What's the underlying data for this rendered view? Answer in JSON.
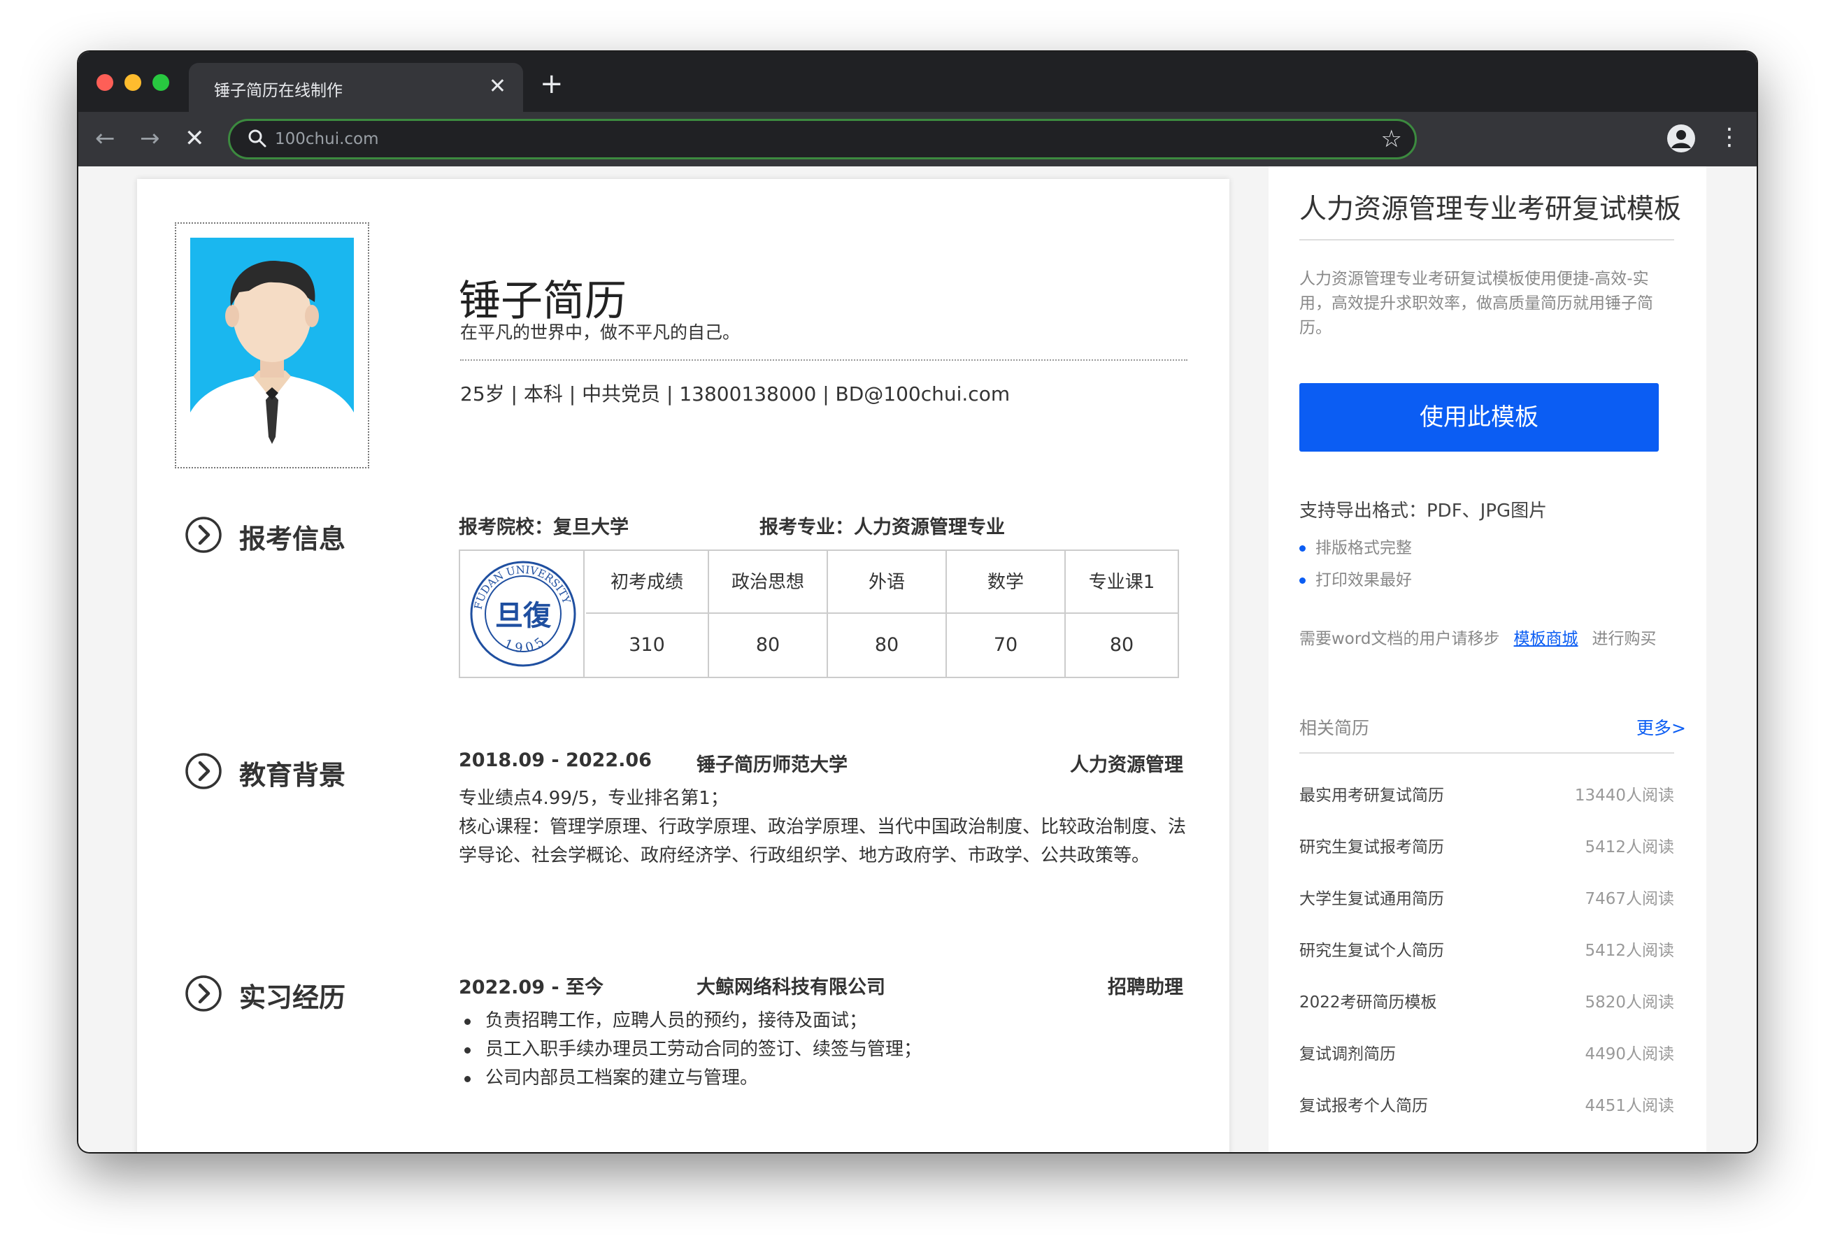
{
  "browser": {
    "tab_title": "锤子简历在线制作",
    "tab_close": "✕",
    "new_tab": "+",
    "url": "100chui.com",
    "nav_back": "←",
    "nav_forward": "→",
    "nav_stop": "✕",
    "star": "☆",
    "menu": "⋮"
  },
  "resume": {
    "name": "锤子简历",
    "motto": "在平凡的世界中，做不平凡的自己。",
    "contact": "25岁 | 本科 | 中共党员 | 13800138000 | BD@100chui.com",
    "apply": {
      "title": "报考信息",
      "school": "报考院校：复旦大学",
      "major": "报考专业：人力资源管理专业",
      "columns": [
        {
          "header": "初考成绩",
          "value": "310"
        },
        {
          "header": "政治思想",
          "value": "80"
        },
        {
          "header": "外语",
          "value": "80"
        },
        {
          "header": "数学",
          "value": "70"
        },
        {
          "header": "专业课1",
          "value": "80"
        }
      ],
      "logo_text_top": "FUDAN UNIVERSITY",
      "logo_year": "1905",
      "logo_glyph": "旦復"
    },
    "education": {
      "title": "教育背景",
      "period": "2018.09 - 2022.06",
      "school": "锤子简历师范大学",
      "major": "人力资源管理",
      "lines": [
        "专业绩点4.99/5，专业排名第1；",
        "核心课程：管理学原理、行政学原理、政治学原理、当代中国政治制度、比较政治制度、法学导论、社会学概论、政府经济学、行政组织学、地方政府学、市政学、公共政策等。"
      ]
    },
    "internship": {
      "title": "实习经历",
      "period": "2022.09 - 至今",
      "company": "大鲸网络科技有限公司",
      "role": "招聘助理",
      "bullets": [
        "负责招聘工作，应聘人员的预约，接待及面试；",
        "员工入职手续办理员工劳动合同的签订、续签与管理；",
        "公司内部员工档案的建立与管理。"
      ]
    }
  },
  "sidebar": {
    "title": "人力资源管理专业考研复试模板",
    "description": "人力资源管理专业考研复试模板使用便捷-高效-实用，高效提升求职效率，做高质量简历就用锤子简历。",
    "use_button": "使用此模板",
    "export_formats": "支持导出格式：PDF、JPG图片",
    "features": [
      "排版格式完整",
      "打印效果最好"
    ],
    "word_prefix": "需要word文档的用户请移步",
    "word_link": "模板商城",
    "word_suffix": "进行购买",
    "related_label": "相关简历",
    "more_link": "更多>",
    "related": [
      {
        "name": "最实用考研复试简历",
        "count": "13440人阅读"
      },
      {
        "name": "研究生复试报考简历",
        "count": "5412人阅读"
      },
      {
        "name": "大学生复试通用简历",
        "count": "7467人阅读"
      },
      {
        "name": "研究生复试个人简历",
        "count": "5412人阅读"
      },
      {
        "name": "2022考研简历模板",
        "count": "5820人阅读"
      },
      {
        "name": "复试调剂简历",
        "count": "4490人阅读"
      },
      {
        "name": "复试报考个人简历",
        "count": "4451人阅读"
      }
    ]
  },
  "colors": {
    "accent": "#0b5df3",
    "photo_bg": "#1ab7ef",
    "titlebar": "#202124",
    "logo_blue": "#1f4fa0"
  },
  "icons": [
    "search-icon",
    "star-icon",
    "account-icon",
    "menu-icon",
    "chevron-right-icon"
  ]
}
